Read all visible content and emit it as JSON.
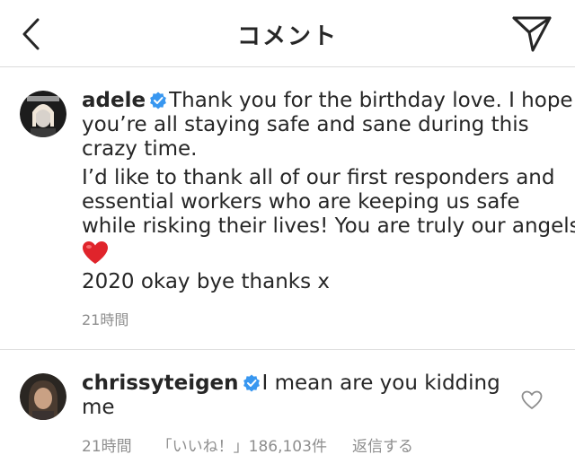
{
  "header": {
    "title": "コメント"
  },
  "caption": {
    "username": "adele",
    "lines": [
      "Thank you for the birthday love. I hope",
      "you’re all staying safe and sane during this",
      "crazy time.",
      "I’d like to thank all of our first responders and",
      "essential workers who are keeping us safe",
      "while risking their lives! You are truly our angels",
      "❤️",
      "2020 okay bye thanks x"
    ],
    "timestamp": "21時間"
  },
  "comment": {
    "username": "chrissyteigen",
    "lines": [
      "I mean are you kidding",
      "me"
    ],
    "timestamp": "21時間",
    "likes": "「いいね！」186,103件",
    "reply_label": "返信する"
  },
  "colors": {
    "text": "#262626",
    "meta": "#8e8e8e",
    "verified": "#3897f0",
    "heart": "#e0242b"
  }
}
